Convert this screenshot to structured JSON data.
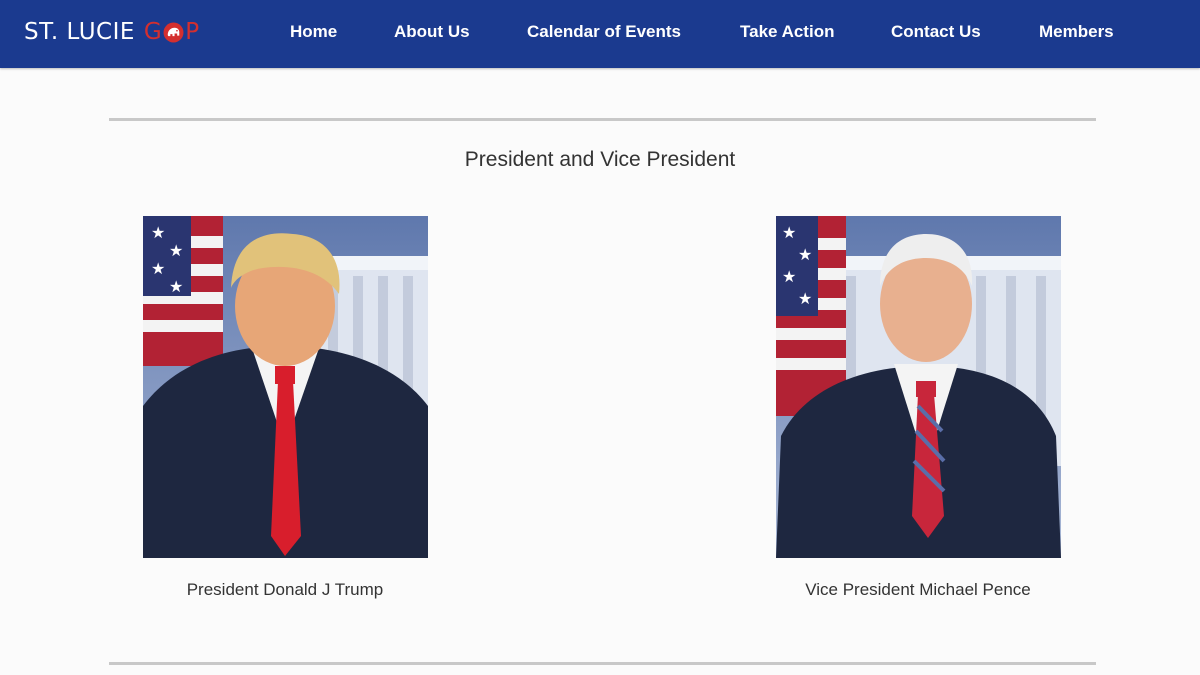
{
  "brand": {
    "text_left": "ST. LUCIE",
    "gop_g": "G",
    "gop_p": "P"
  },
  "nav": {
    "items": [
      {
        "label": "Home"
      },
      {
        "label": "About Us"
      },
      {
        "label": "Calendar of Events"
      },
      {
        "label": "Take Action"
      },
      {
        "label": "Contact Us"
      },
      {
        "label": "Members"
      }
    ]
  },
  "section": {
    "title": "President and Vice President"
  },
  "officials": [
    {
      "caption": "President Donald J Trump"
    },
    {
      "caption": "Vice President Michael Pence"
    }
  ],
  "colors": {
    "navbar": "#1b3a8f",
    "brand_accent": "#d32f2f",
    "portrait_background": "#8fa3c9",
    "suit": "#1e2740"
  }
}
